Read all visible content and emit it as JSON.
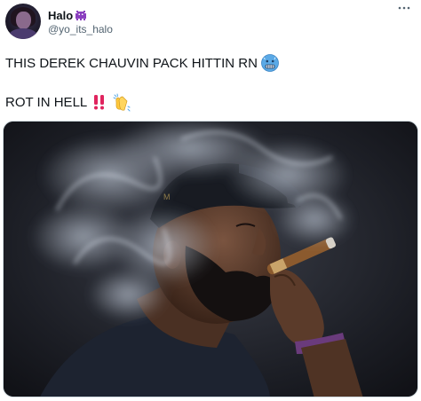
{
  "author": {
    "display_name": "Halo",
    "name_emoji_icon": "alien-monster-icon",
    "handle": "@yo_its_halo"
  },
  "more_menu": {
    "icon": "more-horizontal-icon",
    "label": "···"
  },
  "tweet_text": {
    "line1": "THIS DEREK CHAUVIN PACK HITTIN RN",
    "line1_emoji_icon": "cold-face-icon",
    "line2": "ROT IN HELL",
    "line2_emoji_icons": [
      "double-exclamation-icon",
      "clapping-hands-icon"
    ]
  },
  "media": {
    "type": "photo",
    "subject": "smoking-cigar-photo"
  },
  "colors": {
    "text_primary": "#0f1419",
    "text_secondary": "#536471",
    "border": "#cfd9de",
    "exclamation_red": "#e0245e"
  }
}
